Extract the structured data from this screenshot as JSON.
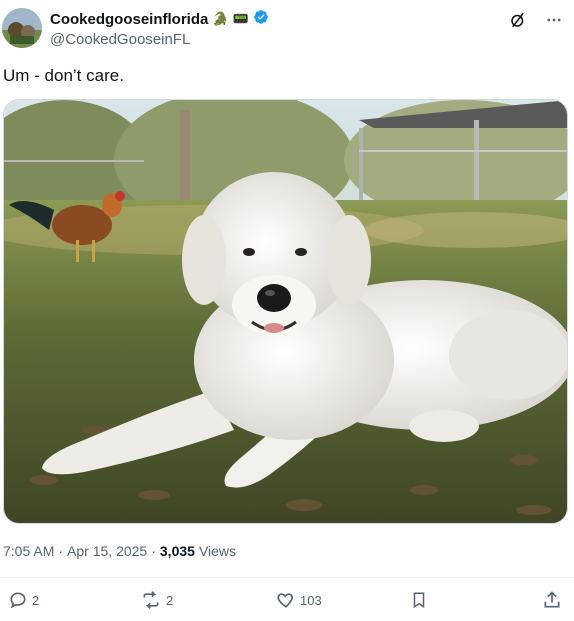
{
  "author": {
    "display_name": "Cookedgooseinflorida",
    "handle": "@CookedGooseinFL",
    "badge_emoji_1": "🐊",
    "badge_emoji_2": "📟"
  },
  "tweet": {
    "text": "Um - don’t care."
  },
  "meta": {
    "time": "7:05 AM",
    "sep1": "·",
    "date": "Apr 15, 2025",
    "sep2": "·",
    "views_count": "3,035",
    "views_label": "Views"
  },
  "actions": {
    "replies": "2",
    "reposts": "2",
    "likes": "103"
  },
  "icons": {
    "verified": "verified-badge-icon",
    "grok": "grok-icon",
    "more": "more-icon",
    "reply": "reply-icon",
    "repost": "repost-icon",
    "like": "heart-icon",
    "bookmark": "bookmark-icon",
    "share": "share-icon"
  },
  "colors": {
    "verified": "#1d9bf0",
    "muted": "#536471",
    "text": "#0f1419"
  }
}
